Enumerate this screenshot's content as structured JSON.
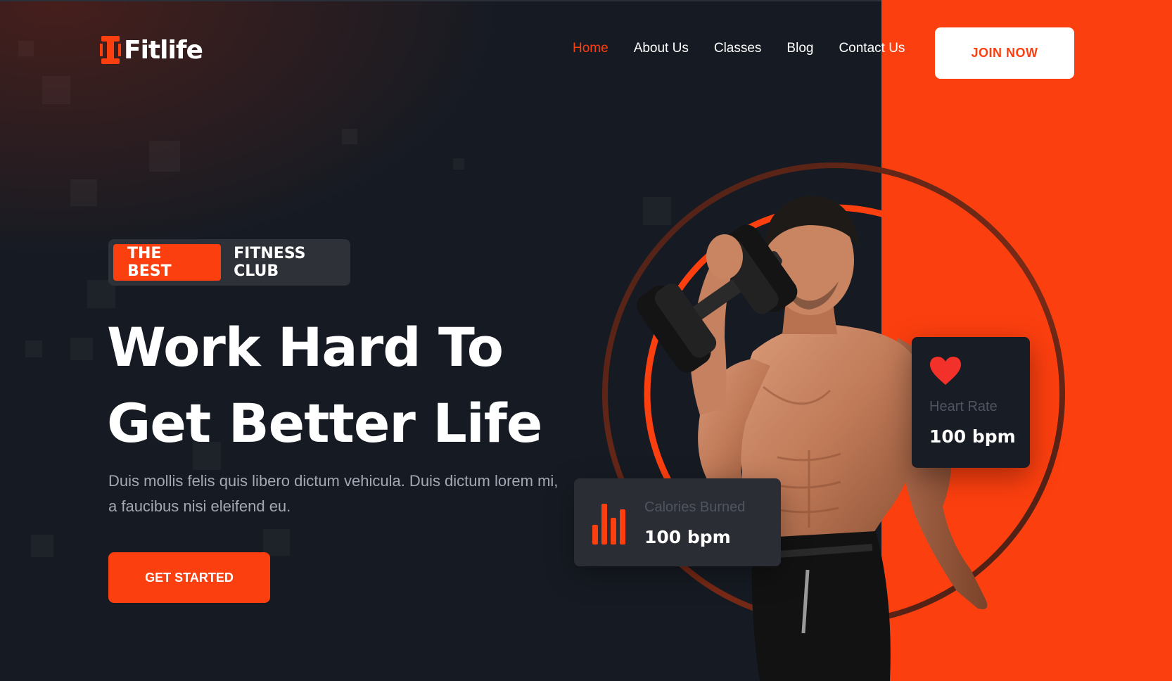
{
  "brand": {
    "name": "Fitlife",
    "accent_color": "#fc3f0f",
    "dark_color": "#161b23"
  },
  "nav": {
    "items": [
      {
        "label": "Home",
        "active": true
      },
      {
        "label": "About Us",
        "active": false
      },
      {
        "label": "Classes",
        "active": false
      },
      {
        "label": "Blog",
        "active": false
      },
      {
        "label": "Contact Us",
        "active": false
      }
    ],
    "join_label": "JOIN NOW"
  },
  "hero": {
    "badge_highlight": "THE BEST",
    "badge_rest": "FITNESS CLUB",
    "headline_line1": "Work Hard To",
    "headline_line2": "Get Better Life",
    "subtext": "Duis mollis felis quis libero dictum vehicula. Duis dictum lorem mi, a faucibus nisi eleifend eu.",
    "cta_label": "GET STARTED",
    "image_icon": "athlete-with-dumbbell"
  },
  "stats": {
    "heart_rate": {
      "label": "Heart Rate",
      "value": "100 bpm",
      "icon": "heart-icon"
    },
    "calories": {
      "label": "Calories Burned",
      "value": "100 bpm",
      "icon": "bar-chart-icon"
    }
  }
}
